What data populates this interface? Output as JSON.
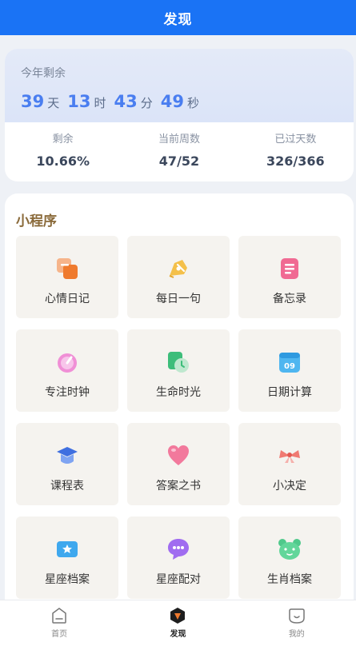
{
  "header": {
    "title": "发现"
  },
  "countdown": {
    "caption": "今年剩余",
    "days": "39",
    "days_unit": "天",
    "hours": "13",
    "hours_unit": "时",
    "minutes": "43",
    "minutes_unit": "分",
    "seconds": "49",
    "seconds_unit": "秒",
    "stats": [
      {
        "label": "剩余",
        "value": "10.66%"
      },
      {
        "label": "当前周数",
        "value": "47/52"
      },
      {
        "label": "已过天数",
        "value": "326/366"
      }
    ]
  },
  "mini_programs": {
    "title": "小程序",
    "items": [
      {
        "label": "心情日记",
        "icon": "mood-diary-icon"
      },
      {
        "label": "每日一句",
        "icon": "pen-icon"
      },
      {
        "label": "备忘录",
        "icon": "memo-icon"
      },
      {
        "label": "专注时钟",
        "icon": "focus-clock-icon"
      },
      {
        "label": "生命时光",
        "icon": "life-time-icon"
      },
      {
        "label": "日期计算",
        "icon": "calendar-icon"
      },
      {
        "label": "课程表",
        "icon": "graduation-cap-icon"
      },
      {
        "label": "答案之书",
        "icon": "heart-icon"
      },
      {
        "label": "小决定",
        "icon": "ribbon-icon"
      },
      {
        "label": "星座档案",
        "icon": "star-ticket-icon"
      },
      {
        "label": "星座配对",
        "icon": "chat-bubble-icon"
      },
      {
        "label": "生肖档案",
        "icon": "bear-face-icon"
      }
    ]
  },
  "tabbar": {
    "home": "首页",
    "discover": "发现",
    "mine": "我的"
  },
  "colors": {
    "primary": "#1a73f5",
    "accent_number": "#4a7ef0",
    "section_title": "#8a6a3a"
  }
}
